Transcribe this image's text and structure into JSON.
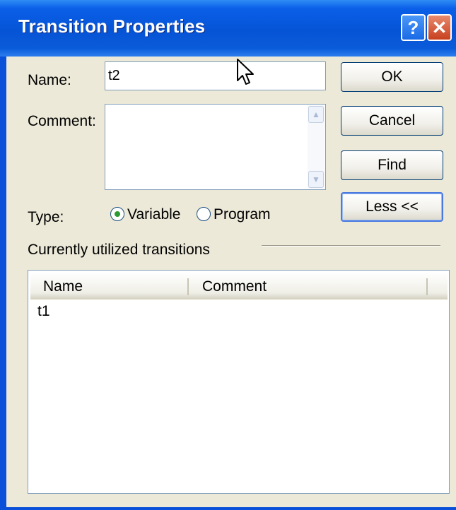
{
  "window": {
    "title": "Transition Properties",
    "help_glyph": "?",
    "close_glyph": "✕"
  },
  "form": {
    "name_label": "Name:",
    "name_value": "t2",
    "comment_label": "Comment:",
    "comment_value": "",
    "type_label": "Type:",
    "type_options": [
      {
        "label": "Variable",
        "selected": true
      },
      {
        "label": "Program",
        "selected": false
      }
    ]
  },
  "buttons": {
    "ok": "OK",
    "cancel": "Cancel",
    "find": "Find",
    "less": "Less <<"
  },
  "transitions": {
    "group_label": "Currently utilized transitions",
    "columns": [
      "Name",
      "Comment"
    ],
    "rows": [
      {
        "name": "t1",
        "comment": ""
      }
    ]
  },
  "colors": {
    "title_bar": "#0654d6",
    "dialog_face": "#ece9d8",
    "radio_dot": "#2c9b32"
  }
}
